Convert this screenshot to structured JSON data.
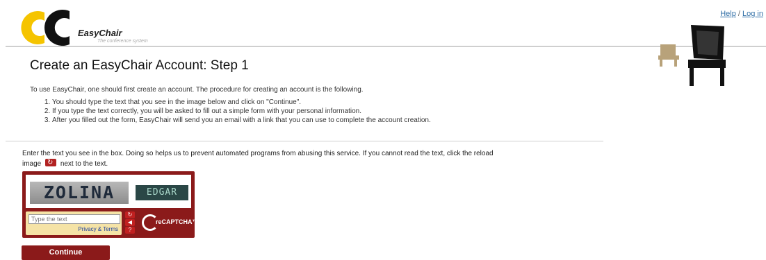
{
  "header": {
    "links": {
      "help": "Help",
      "separator": "/",
      "login": "Log in"
    },
    "logo": {
      "name": "EasyChair",
      "tagline": "The conference system"
    }
  },
  "page": {
    "title": "Create an EasyChair Account: Step 1",
    "intro": "To use EasyChair, one should first create an account. The procedure for creating an account is the following.",
    "steps": [
      "You should type the text that you see in the image below and click on \"Continue\".",
      "If you type the text correctly, you will be asked to fill out a simple form with your personal information.",
      "After you filled out the form, EasyChair will send you an email with a link that you can use to complete the account creation."
    ]
  },
  "captcha": {
    "instructions_part1": "Enter the text you see in the box. Doing so helps us to prevent automated programs from abusing this service. If you cannot read the text, click the reload image",
    "instructions_part2": "next to the text.",
    "word1": "ZOLINA",
    "word2": "EDGAR",
    "input_placeholder": "Type the text",
    "privacy_link": "Privacy & Terms",
    "logo_text": "reCAPTCHA™"
  },
  "actions": {
    "continue_label": "Continue"
  },
  "colors": {
    "brand_red": "#8b1a1a",
    "logo_yellow": "#f5c400",
    "link_blue": "#2f6ea6"
  }
}
